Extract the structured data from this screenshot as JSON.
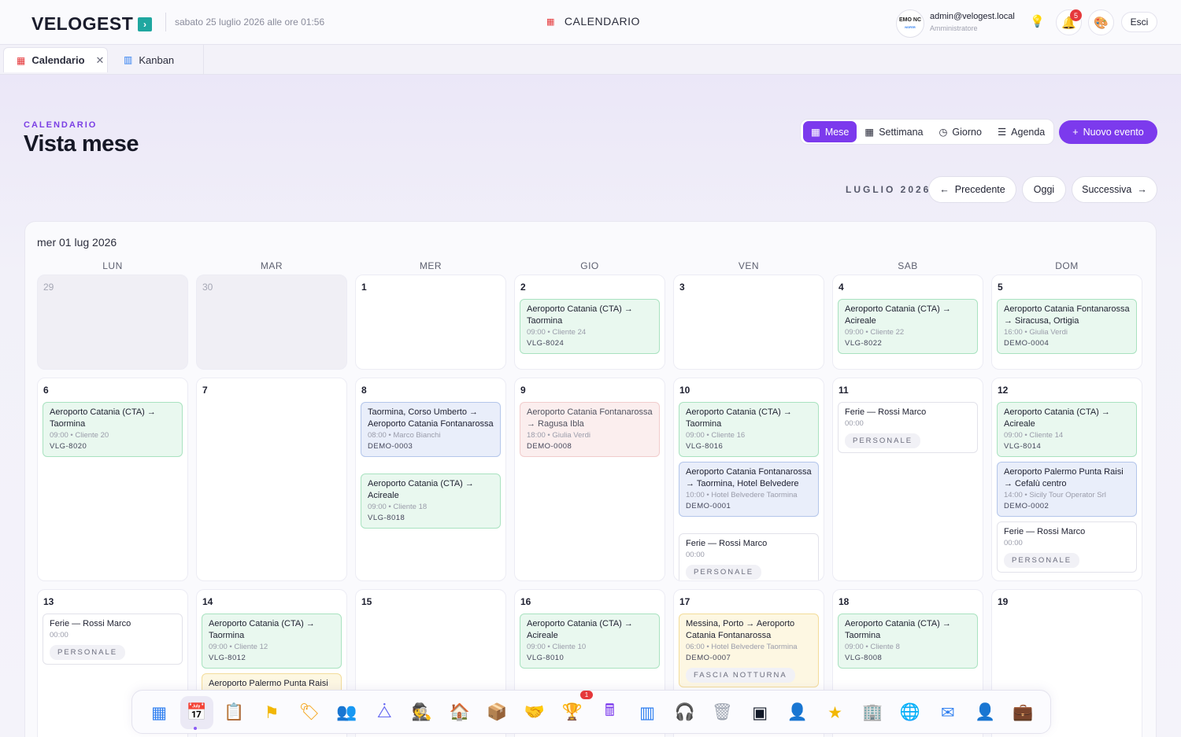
{
  "app": {
    "logo": "VELOGEST",
    "datetime": "sabato 25 luglio 2026 alle ore 01:56",
    "center_title": "CALENDARIO"
  },
  "user": {
    "logo_text_1": "EMO NC",
    "logo_text_2": "NSFER",
    "email": "admin@velogest.local",
    "role": "Amministratore"
  },
  "header": {
    "notif_count": "5",
    "logout": "Esci"
  },
  "tabs": [
    {
      "label": "Calendario",
      "close": "✕"
    },
    {
      "label": "Kanban"
    }
  ],
  "page": {
    "section": "CALENDARIO",
    "title": "Vista mese"
  },
  "views": {
    "month": "Mese",
    "week": "Settimana",
    "day": "Giorno",
    "agenda": "Agenda"
  },
  "new_event": "Nuovo evento",
  "nav": {
    "month_label": "LUGLIO 2026",
    "prev": "Precedente",
    "today": "Oggi",
    "next": "Successiva"
  },
  "calendar": {
    "selected_date": "mer 01 lug 2026",
    "weekdays": [
      "LUN",
      "MAR",
      "MER",
      "GIO",
      "VEN",
      "SAB",
      "DOM"
    ],
    "days": [
      {
        "n": "29",
        "other": true,
        "events": []
      },
      {
        "n": "30",
        "other": true,
        "events": []
      },
      {
        "n": "1",
        "events": []
      },
      {
        "n": "2",
        "events": [
          {
            "color": "green",
            "title": "Aeroporto Catania (CTA) → Taormina",
            "sub": "09:00 • Cliente 24",
            "code": "VLG-8024"
          }
        ]
      },
      {
        "n": "3",
        "events": []
      },
      {
        "n": "4",
        "events": [
          {
            "color": "green",
            "title": "Aeroporto Catania (CTA) → Acireale",
            "sub": "09:00 • Cliente 22",
            "code": "VLG-8022"
          }
        ]
      },
      {
        "n": "5",
        "events": [
          {
            "color": "green",
            "title": "Aeroporto Catania Fontanarossa → Siracusa, Ortigia",
            "sub": "16:00 • Giulia Verdi",
            "code": "DEMO-0004"
          }
        ]
      },
      {
        "n": "6",
        "events": [
          {
            "color": "green",
            "title": "Aeroporto Catania (CTA) → Taormina",
            "sub": "09:00 • Cliente 20",
            "code": "VLG-8020"
          }
        ]
      },
      {
        "n": "7",
        "events": []
      },
      {
        "n": "8",
        "events": [
          {
            "color": "blue",
            "title": "Taormina, Corso Umberto → Aeroporto Catania Fontanarossa",
            "sub": "08:00 • Marco Bianchi",
            "code": "DEMO-0003"
          },
          {
            "color": "green",
            "title": "Aeroporto Catania (CTA) → Acireale",
            "sub": "09:00 • Cliente 18",
            "code": "VLG-8018"
          }
        ]
      },
      {
        "n": "9",
        "events": [
          {
            "color": "pink",
            "title": "Aeroporto Catania Fontanarossa → Ragusa Ibla",
            "sub": "18:00 • Giulia Verdi",
            "code": "DEMO-0008"
          }
        ]
      },
      {
        "n": "10",
        "events": [
          {
            "color": "green",
            "title": "Aeroporto Catania (CTA) → Taormina",
            "sub": "09:00 • Cliente 16",
            "code": "VLG-8016"
          },
          {
            "color": "blue",
            "title": "Aeroporto Catania Fontanarossa → Taormina, Hotel Belvedere",
            "sub": "10:00 • Hotel Belvedere Taormina",
            "code": "DEMO-0001"
          },
          {
            "color": "white",
            "title": "Ferie — Rossi Marco",
            "time": "00:00",
            "tag": "PERSONALE"
          }
        ]
      },
      {
        "n": "11",
        "events": [
          {
            "color": "white",
            "title": "Ferie — Rossi Marco",
            "time": "00:00",
            "tag": "PERSONALE"
          }
        ]
      },
      {
        "n": "12",
        "events": [
          {
            "color": "green",
            "title": "Aeroporto Catania (CTA) → Acireale",
            "sub": "09:00 • Cliente 14",
            "code": "VLG-8014"
          },
          {
            "color": "blue",
            "title": "Aeroporto Palermo Punta Raisi → Cefalù centro",
            "sub": "14:00 • Sicily Tour Operator Srl",
            "code": "DEMO-0002"
          },
          {
            "color": "white",
            "title": "Ferie — Rossi Marco",
            "time": "00:00",
            "tag": "PERSONALE"
          }
        ]
      },
      {
        "n": "13",
        "events": [
          {
            "color": "white",
            "title": "Ferie — Rossi Marco",
            "time": "00:00",
            "tag": "PERSONALE"
          }
        ]
      },
      {
        "n": "14",
        "events": [
          {
            "color": "green",
            "title": "Aeroporto Catania (CTA) → Taormina",
            "sub": "09:00 • Cliente 12",
            "code": "VLG-8012"
          },
          {
            "color": "yellow",
            "title": "Aeroporto Palermo Punta Raisi"
          }
        ]
      },
      {
        "n": "15",
        "events": []
      },
      {
        "n": "16",
        "events": [
          {
            "color": "green",
            "title": "Aeroporto Catania (CTA) → Acireale",
            "sub": "09:00 • Cliente 10",
            "code": "VLG-8010"
          }
        ]
      },
      {
        "n": "17",
        "events": [
          {
            "color": "yellow",
            "title": "Messina, Porto → Aeroporto Catania Fontanarossa",
            "sub": "06:00 • Hotel Belvedere Taormina",
            "code": "DEMO-0007",
            "tag": "FASCIA NOTTURNA"
          }
        ]
      },
      {
        "n": "18",
        "events": [
          {
            "color": "green",
            "title": "Aeroporto Catania (CTA) → Taormina",
            "sub": "09:00 • Cliente 8",
            "code": "VLG-8008"
          }
        ]
      },
      {
        "n": "19",
        "events": []
      }
    ]
  },
  "dock": {
    "badge": "1",
    "items": [
      {
        "icon": "apps-grid-icon",
        "glyph": "▦",
        "color": "#2f7ff0"
      },
      {
        "icon": "calendar-icon",
        "glyph": "📅",
        "color": "#e5383b"
      },
      {
        "icon": "clipboard-check-icon",
        "glyph": "📋",
        "color": "#2f7ff0"
      },
      {
        "icon": "flag-icon",
        "glyph": "⚑",
        "color": "#f2b705"
      },
      {
        "icon": "tag-icon",
        "glyph": "🏷",
        "color": "#f59e0b"
      },
      {
        "icon": "users-icon",
        "glyph": "👥",
        "color": "#2f7ff0"
      },
      {
        "icon": "network-icon",
        "glyph": "⧊",
        "color": "#6366f1"
      },
      {
        "icon": "agent-icon",
        "glyph": "🕵",
        "color": "#1e3a8a"
      },
      {
        "icon": "garage-icon",
        "glyph": "🏠",
        "color": "#dc2626"
      },
      {
        "icon": "box-icon",
        "glyph": "📦",
        "color": "#f59e0b"
      },
      {
        "icon": "handshake-icon",
        "glyph": "🤝",
        "color": "#16a34a"
      },
      {
        "icon": "podium-icon",
        "glyph": "🏆",
        "color": "#4338ca"
      },
      {
        "icon": "calculator-icon",
        "glyph": "🖩",
        "color": "#7c3aed"
      },
      {
        "icon": "kanban-icon",
        "glyph": "▥",
        "color": "#2f7ff0"
      },
      {
        "icon": "headset-icon",
        "glyph": "🎧",
        "color": "#2f7ff0"
      },
      {
        "icon": "trash-icon",
        "glyph": "🗑",
        "color": "#9ca3af"
      },
      {
        "icon": "terminal-icon",
        "glyph": "▣",
        "color": "#111827"
      },
      {
        "icon": "user-add-icon",
        "glyph": "👤",
        "color": "#4f46e5"
      },
      {
        "icon": "star-icon",
        "glyph": "★",
        "color": "#f2b705"
      },
      {
        "icon": "building-icon",
        "glyph": "🏢",
        "color": "#2f7ff0"
      },
      {
        "icon": "globe-icon",
        "glyph": "🌐",
        "color": "#2f7ff0"
      },
      {
        "icon": "mail-icon",
        "glyph": "✉",
        "color": "#2f7ff0"
      },
      {
        "icon": "user-settings-icon",
        "glyph": "👤",
        "color": "#f59e0b"
      },
      {
        "icon": "briefcase-icon",
        "glyph": "💼",
        "color": "#7c3aed"
      }
    ]
  }
}
